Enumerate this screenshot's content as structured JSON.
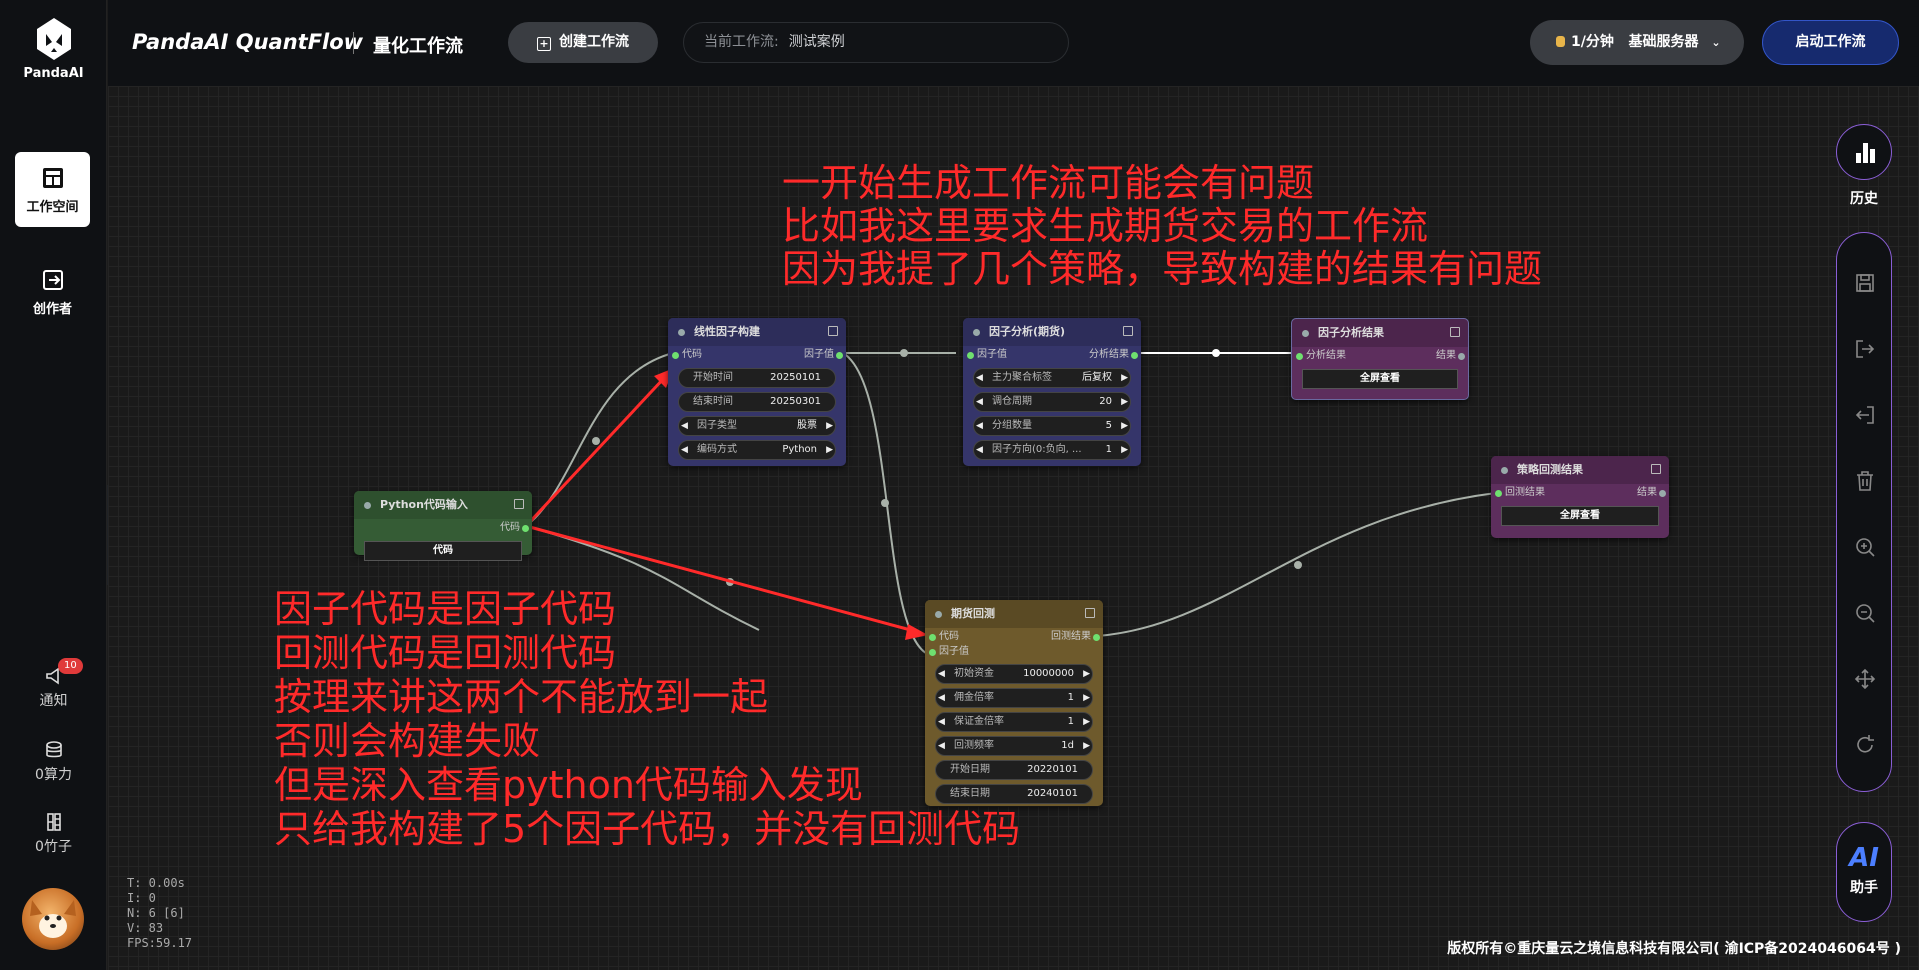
{
  "app": {
    "logo_text": "PandaAI",
    "brand": "PandaAI QuantFlow",
    "subtitle": "量化工作流"
  },
  "header": {
    "create_label": "创建工作流",
    "current_label": "当前工作流:",
    "current_value": "测试案例",
    "server_rate": "1/分钟",
    "server_name": "基础服务器",
    "start_label": "启动工作流"
  },
  "sidebar": {
    "workspace": "工作空间",
    "creator": "创作者",
    "notify": "通知",
    "notify_count": "10",
    "compute": "0算力",
    "bamboo": "0竹子"
  },
  "right_toolbar": {
    "history": "历史",
    "ai_label": "AI",
    "assistant": "助手"
  },
  "nodes": {
    "python": {
      "title": "Python代码输入",
      "out": "代码",
      "btn": "代码"
    },
    "linear": {
      "title": "线性因子构建",
      "in": "代码",
      "out": "因子值",
      "fields": [
        {
          "label": "开始时间",
          "value": "20250101"
        },
        {
          "label": "结束时间",
          "value": "20250301"
        },
        {
          "label": "因子类型",
          "value": "股票"
        },
        {
          "label": "编码方式",
          "value": "Python"
        }
      ]
    },
    "analysis": {
      "title": "因子分析(期货)",
      "in": "因子值",
      "out": "分析结果",
      "fields": [
        {
          "label": "主力聚合标签",
          "value": "后复权"
        },
        {
          "label": "调仓周期",
          "value": "20"
        },
        {
          "label": "分组数量",
          "value": "5"
        },
        {
          "label": "因子方向(0:负向, ...",
          "value": "1"
        }
      ]
    },
    "result": {
      "title": "因子分析结果",
      "in": "分析结果",
      "out": "结果",
      "btn": "全屏查看"
    },
    "backtest_result": {
      "title": "策略回测结果",
      "in": "回测结果",
      "out": "结果",
      "btn": "全屏查看"
    },
    "futures": {
      "title": "期货回测",
      "in1": "代码",
      "in2": "因子值",
      "out": "回测结果",
      "fields": [
        {
          "label": "初始资金",
          "value": "10000000"
        },
        {
          "label": "佣金倍率",
          "value": "1"
        },
        {
          "label": "保证金倍率",
          "value": "1"
        },
        {
          "label": "回测频率",
          "value": "1d"
        }
      ],
      "plain": [
        {
          "label": "开始日期",
          "value": "20220101"
        },
        {
          "label": "结束日期",
          "value": "20240101"
        }
      ]
    }
  },
  "annotations": {
    "top": [
      "一开始生成工作流可能会有问题",
      "比如我这里要求生成期货交易的工作流",
      "因为我提了几个策略，导致构建的结果有问题"
    ],
    "bottom": [
      "因子代码是因子代码",
      "回测代码是回测代码",
      "按理来讲这两个不能放到一起",
      "否则会构建失败",
      "但是深入查看python代码输入发现",
      "只给我构建了5个因子代码，并没有回测代码"
    ]
  },
  "stats": [
    "T: 0.00s",
    "I: 0",
    "N: 6 [6]",
    "V: 83",
    "FPS:59.17"
  ],
  "copyright": "版权所有©重庆量云之境信息科技有限公司( 渝ICP备2024046064号 )",
  "colors": {
    "red_annotation": "#ff2a2a",
    "accent_purple": "#8a5ed6",
    "start_button": "#162a6e"
  }
}
